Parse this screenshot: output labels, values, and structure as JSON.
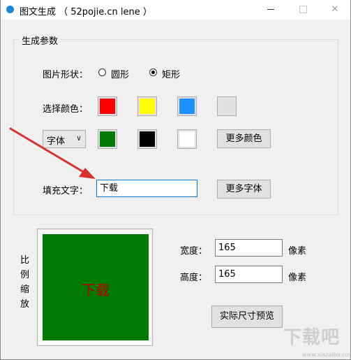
{
  "window": {
    "title": "图文生成 （ 52pojie.cn lene ）",
    "minimize": "—",
    "close": "✕"
  },
  "group": {
    "legend": "生成参数",
    "shape_label": "图片形状：",
    "shape_options": [
      {
        "label": "圆形",
        "checked": false
      },
      {
        "label": "矩形",
        "checked": true
      }
    ],
    "color_label": "选择颜色：",
    "color_swatches_row1": [
      "#ff0000",
      "#ffff00",
      "#1e90ff",
      "#e0e0e0"
    ],
    "font_select": {
      "value": "字体",
      "arrow": "∨"
    },
    "color_swatches_row2": [
      "#007a00",
      "#000000",
      "#ffffff"
    ],
    "more_colors_button": "更多颜色",
    "fill_text_label": "填充文字：",
    "fill_text_value": "下载",
    "more_fonts_button": "更多字体"
  },
  "preview": {
    "scale_label_chars": [
      "比",
      "例",
      "缩",
      "放"
    ],
    "text": "下载",
    "fill_color": "#007a00",
    "text_color": "#b80000"
  },
  "size": {
    "width_label": "宽度：",
    "width_value": "165",
    "width_unit": "像素",
    "height_label": "高度：",
    "height_value": "165",
    "height_unit": "像素",
    "preview_button": "实际尺寸预览"
  },
  "watermark": {
    "text": "下载吧",
    "sub": "www.xiazaiba.com"
  },
  "colors": {
    "accent": "#0078d7",
    "arrow": "#d9302b"
  }
}
